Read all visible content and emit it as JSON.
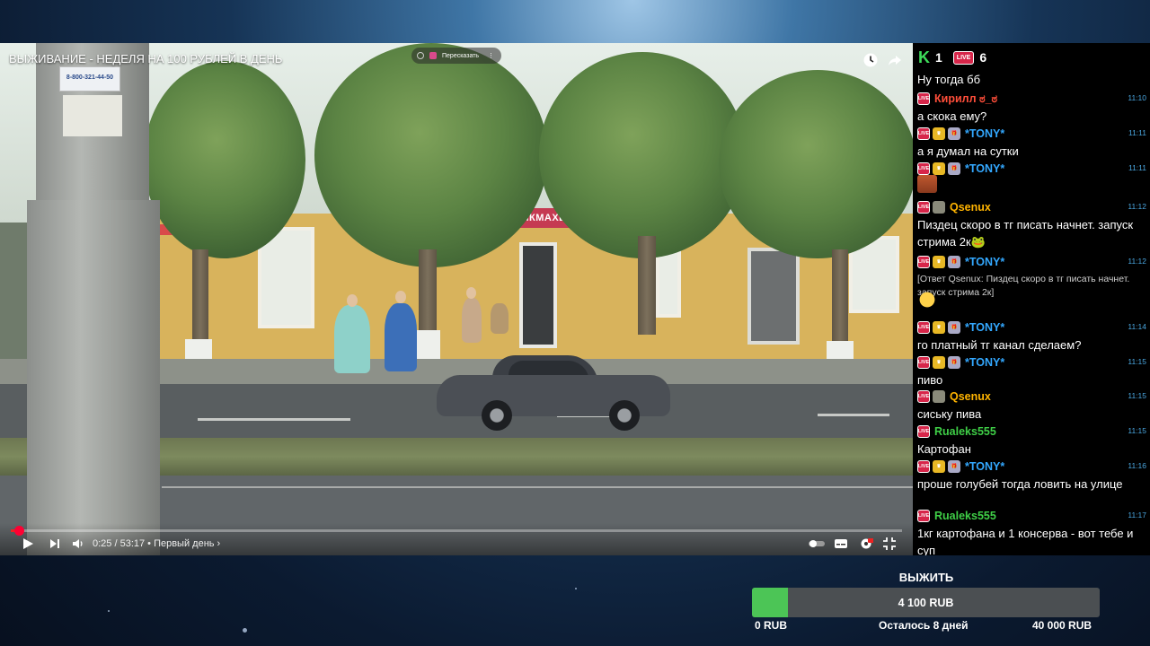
{
  "player": {
    "title": "ВЫЖИВАНИЕ - НЕДЕЛЯ НА 100 РУБЛЕЙ В ДЕНЬ",
    "overlay_pill_label": "Пересказать",
    "time": "0:25 / 53:17 • Первый день ›",
    "progress_fraction": 0.008,
    "icons": {
      "clock": "clock-icon",
      "share": "share-icon",
      "play": "play-icon",
      "next": "next-icon",
      "volume": "volume-icon",
      "settings": "settings-icon",
      "fullscreen": "fullscreen-exit-icon"
    },
    "scene": {
      "shop_sign": "ПАРИКМАХЕРСКАЯ",
      "poster_phone": "8-800-321-44-50"
    }
  },
  "chat": {
    "counters": [
      {
        "icon": "k-icon",
        "value": "1"
      },
      {
        "icon": "live-icon",
        "value": "6"
      }
    ],
    "badge_live": "LIVE",
    "messages": [
      {
        "text": "Ну тогда бб"
      },
      {
        "user": "Кирилл ಠ_ಠ",
        "color": "#ff4e3a",
        "badges": [
          "live"
        ],
        "time": "11:10",
        "text": "а скока ему?"
      },
      {
        "user": "*TONY*",
        "color": "#33a8ff",
        "badges": [
          "live",
          "crown",
          "gift"
        ],
        "time": "11:11",
        "text": "а я думал на сутки"
      },
      {
        "user": "*TONY*",
        "color": "#33a8ff",
        "badges": [
          "live",
          "crown",
          "gift"
        ],
        "time": "11:11",
        "emote": "face-emote"
      },
      {
        "user": "Qsenux",
        "color": "#ffb400",
        "badges": [
          "live",
          "img"
        ],
        "time": "11:12",
        "text": "Пиздец скоро в тг писать начнет. запуск стрима 2к🐸"
      },
      {
        "user": "*TONY*",
        "color": "#33a8ff",
        "badges": [
          "live",
          "crown",
          "gift"
        ],
        "time": "11:12",
        "quote": "[Ответ Qsenux: Пиздец скоро в тг писать начнет. запуск стрима 2к]",
        "emote": "laugh-emote"
      },
      {
        "user": "*TONY*",
        "color": "#33a8ff",
        "badges": [
          "live",
          "crown",
          "gift"
        ],
        "time": "11:14",
        "text": "го платный тг канал сделаем?"
      },
      {
        "user": "*TONY*",
        "color": "#33a8ff",
        "badges": [
          "live",
          "crown",
          "gift"
        ],
        "time": "11:15",
        "text": "пиво"
      },
      {
        "user": "Qsenux",
        "color": "#ffb400",
        "badges": [
          "live",
          "img"
        ],
        "time": "11:15",
        "text": "сиську пива"
      },
      {
        "user": "Rualeks555",
        "color": "#3fcf47",
        "badges": [
          "live"
        ],
        "time": "11:15",
        "text": "Картофан"
      },
      {
        "user": "*TONY*",
        "color": "#33a8ff",
        "badges": [
          "live",
          "crown",
          "gift"
        ],
        "time": "11:16",
        "text": "проше голубей тогда ловить на улице"
      },
      {
        "user": "Rualeks555",
        "color": "#3fcf47",
        "badges": [
          "live"
        ],
        "time": "11:17",
        "text": "1кг картофана и 1 консерва - вот тебе и суп"
      }
    ]
  },
  "goal": {
    "title": "ВЫЖИТЬ",
    "current": "4 100 RUB",
    "min": "0 RUB",
    "max": "40 000 RUB",
    "remaining": "Осталось 8 дней",
    "progress_fraction": 0.1025,
    "fill_color": "#4cc556"
  }
}
